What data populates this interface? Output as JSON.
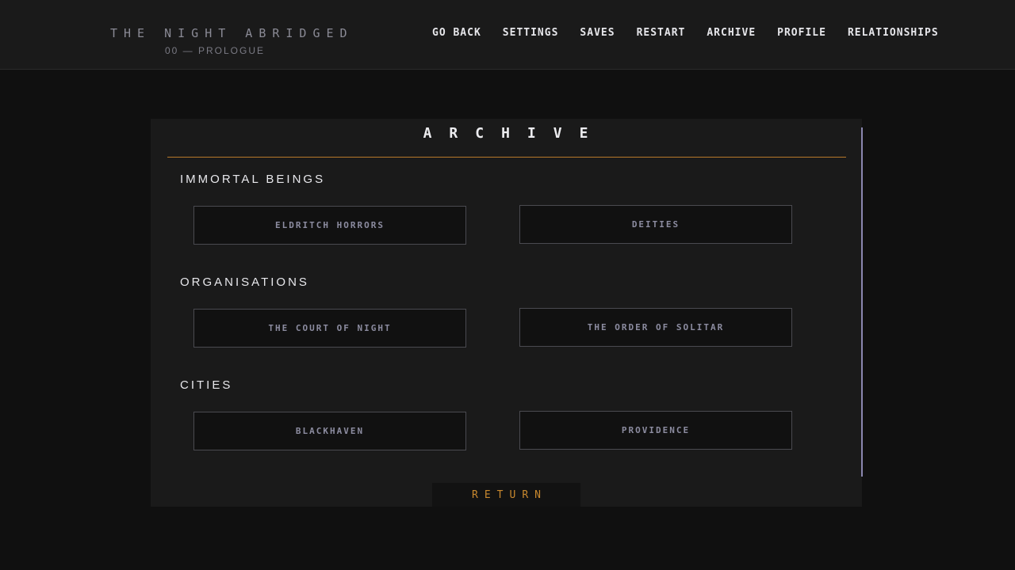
{
  "brand": {
    "title": "THE NIGHT ABRIDGED",
    "subtitle": "00 — PROLOGUE"
  },
  "nav": {
    "items": [
      "GO BACK",
      "SETTINGS",
      "SAVES",
      "RESTART",
      "ARCHIVE",
      "PROFILE",
      "RELATIONSHIPS"
    ]
  },
  "archive": {
    "title": "ARCHIVE",
    "sections": [
      {
        "heading": "IMMORTAL BEINGS",
        "entries": [
          "ELDRITCH HORRORS",
          "DEITIES"
        ]
      },
      {
        "heading": "ORGANISATIONS",
        "entries": [
          "THE COURT OF NIGHT",
          "THE ORDER OF SOLITAR"
        ]
      },
      {
        "heading": "CITIES",
        "entries": [
          "BLACKHAVEN",
          "PROVIDENCE"
        ]
      }
    ],
    "return_label": "RETURN"
  },
  "colors": {
    "accent": "#c8882e",
    "scrollbar": "#8b87b0",
    "entry_text": "#8c8ca0"
  }
}
